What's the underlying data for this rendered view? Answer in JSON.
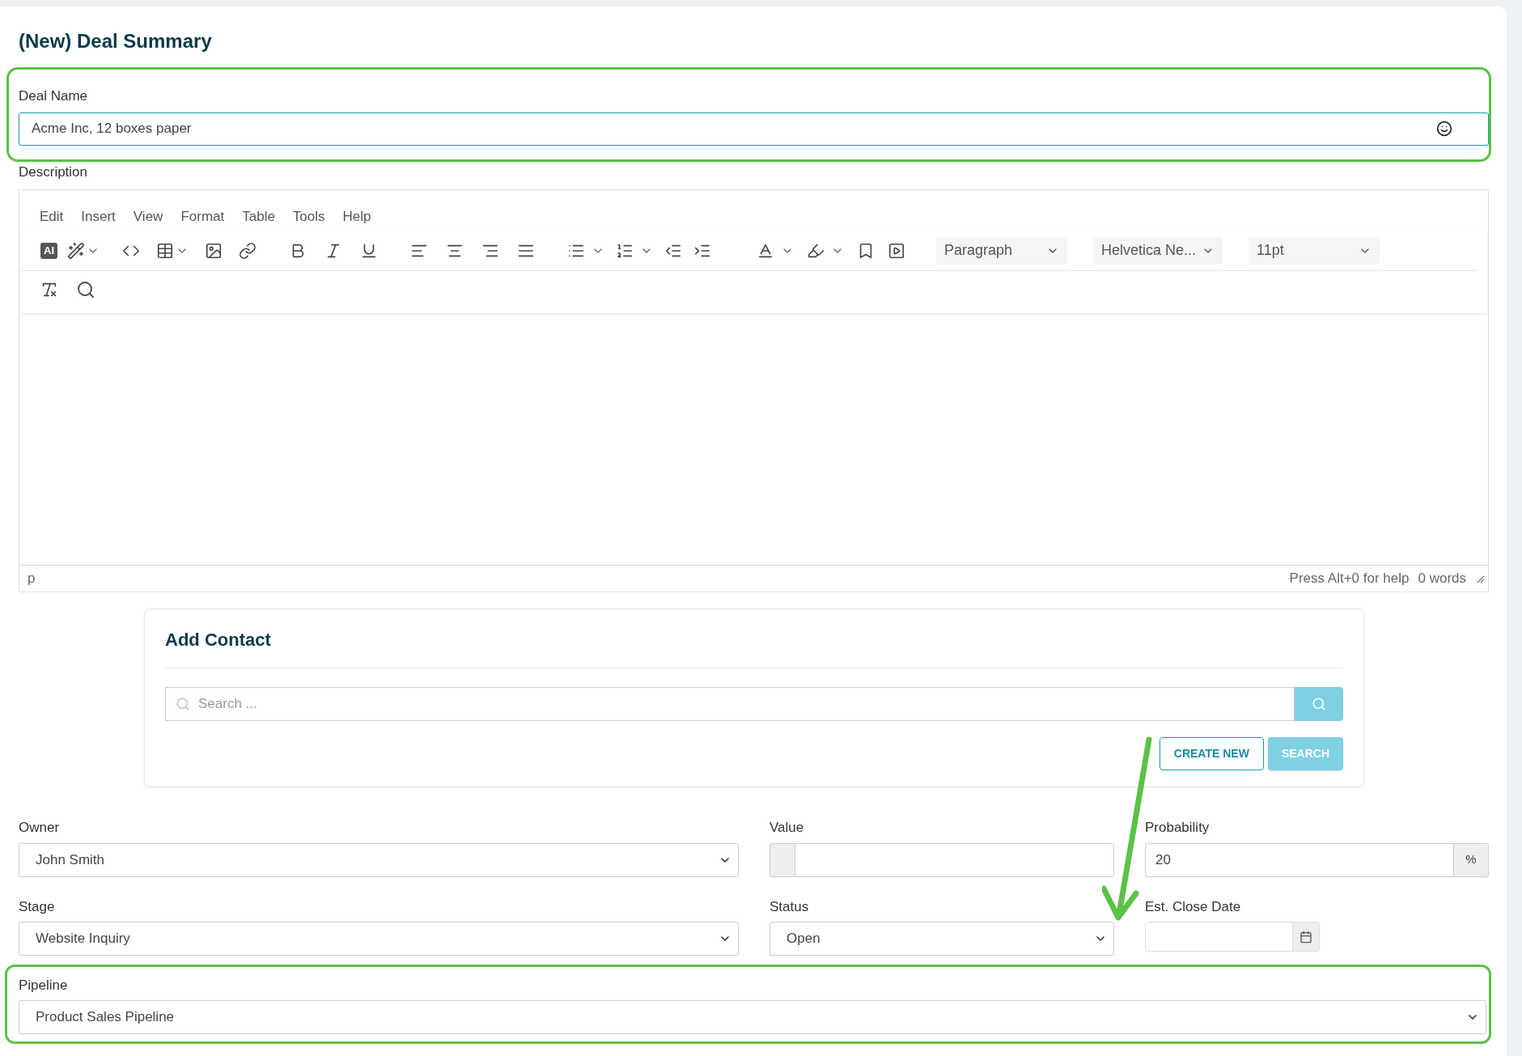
{
  "title": "(New) Deal Summary",
  "deal_name": {
    "label": "Deal Name",
    "value": "Acme Inc, 12 boxes paper"
  },
  "description": {
    "label": "Description",
    "menu": [
      "Edit",
      "Insert",
      "View",
      "Format",
      "Table",
      "Tools",
      "Help"
    ],
    "ai_label": "AI",
    "dropdowns": [
      {
        "value": "Paragraph"
      },
      {
        "value": "Helvetica Ne..."
      },
      {
        "value": "11pt"
      }
    ],
    "status_path": "p",
    "help": "Press Alt+0 for help",
    "word_count": "0 words"
  },
  "add_contact": {
    "title": "Add Contact",
    "placeholder": "Search ...",
    "buttons": [
      {
        "label": "CREATE NEW",
        "kind": "outline"
      },
      {
        "label": "SEARCH",
        "kind": "filled"
      }
    ]
  },
  "fields": [
    {
      "label": "Owner",
      "kind": "select",
      "value": "John Smith"
    },
    {
      "label": "Value",
      "kind": "prefix"
    },
    {
      "label": "Probability",
      "kind": "suffix",
      "value": "20",
      "addon": "%"
    },
    {
      "label": "Stage",
      "kind": "select",
      "value": "Website Inquiry"
    },
    {
      "label": "Status",
      "kind": "select",
      "value": "Open"
    },
    {
      "label": "Est. Close Date",
      "kind": "date"
    }
  ],
  "pipeline": {
    "label": "Pipeline",
    "value": "Product Sales Pipeline"
  }
}
